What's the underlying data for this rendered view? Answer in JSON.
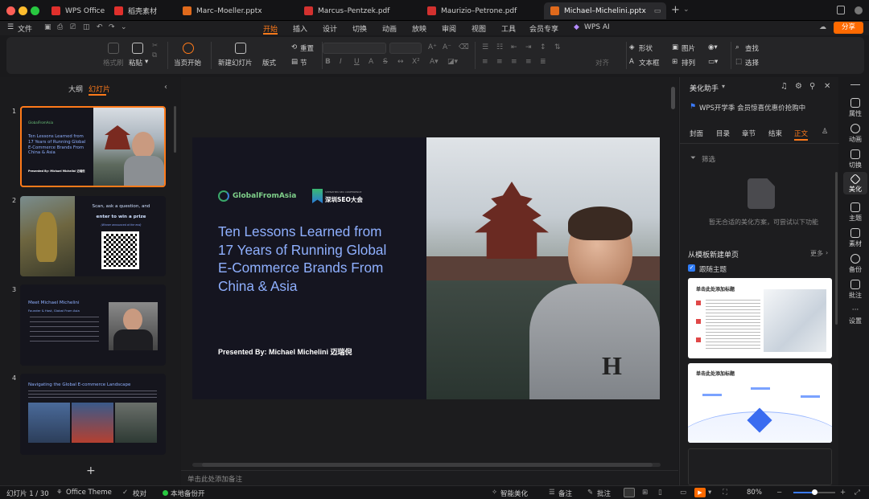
{
  "tabs": [
    {
      "label": "WPS Office",
      "color": "#e0302c"
    },
    {
      "label": "稻壳素材",
      "color": "#e0302c"
    },
    {
      "label": "Marc–Moeller.pptx",
      "color": "#e06a1c"
    },
    {
      "label": "Marcus–Pentzek.pdf",
      "color": "#d3312f"
    },
    {
      "label": "Maurizio–Petrone.pdf",
      "color": "#d3312f"
    },
    {
      "label": "Michael–Michelini.pptx",
      "color": "#e06a1c"
    }
  ],
  "menu": {
    "file": "文件",
    "items": [
      "开始",
      "插入",
      "设计",
      "切换",
      "动画",
      "放映",
      "审阅",
      "视图",
      "工具",
      "会员专享"
    ],
    "ai": "WPS AI",
    "share": "分享"
  },
  "ribbon": {
    "format_painter": "格式刷",
    "paste": "粘贴",
    "start_from_current": "当页开始",
    "new_slide": "新建幻灯片",
    "layout": "版式",
    "section": "节",
    "reset": "重置",
    "align": "对齐",
    "shape": "形状",
    "picture": "图片",
    "find": "查找",
    "textbox": "文本框",
    "arrange": "排列",
    "select": "选择"
  },
  "left_panel": {
    "outline_tab": "大纲",
    "slides_tab": "幻灯片",
    "add_button": "+"
  },
  "thumbs": [
    {
      "num": "1",
      "lines": [
        "Ten Lessons Learned from",
        "17 Years of Running Global",
        "E-Commerce Brands From",
        "China & Asia"
      ],
      "presenter": "Presented By: Michael Michelini 迈瑞倪"
    },
    {
      "num": "2",
      "l1": "Scan, ask a question, and",
      "l2": "enter to win a prize",
      "l3": "(Winner announced at the end)"
    },
    {
      "num": "3",
      "title": "Meet Michael Michelini",
      "sub": "Founder & Host, Global From Asia"
    },
    {
      "num": "4",
      "title": "Navigating the Global E-commerce Landscape"
    }
  ],
  "slide": {
    "logo1": "GlobalFromAsia",
    "logo2": "深圳SEO大会",
    "logo2_sub": "SHENZHEN SEO CONFERENCE",
    "title": [
      "Ten Lessons Learned from",
      "17 Years of Running Global",
      "E-Commerce Brands From",
      "China & Asia"
    ],
    "presenter": "Presented By: Michael Michelini 迈瑞倪"
  },
  "notes_placeholder": "单击此处添加备注",
  "right_panel": {
    "title": "美化助手",
    "promo": "WPS开学季 会员惊喜优惠价抢购中",
    "tabs": [
      "封面",
      "目录",
      "章节",
      "结束",
      "正文"
    ],
    "filter": "筛选",
    "empty": "暂无合适的美化方案，可尝试以下功能",
    "template_title": "从模板新建单页",
    "more": "更多",
    "follow": "跟随主题",
    "card_title": "单击此处添加标题"
  },
  "right_bar": [
    "属性",
    "动画",
    "切换",
    "美化",
    "主题",
    "素材",
    "备份",
    "批注",
    "设置"
  ],
  "status": {
    "slide_count": "幻灯片 1 / 30",
    "theme": "Office Theme",
    "proofread": "校对",
    "backup": "本地备份开",
    "smart": "智能美化",
    "notes": "备注",
    "comments": "批注",
    "zoom": "80%"
  },
  "colors": {
    "accent": "#ff7a1a",
    "slide_title": "#8fb0ff",
    "slide_bg": "#151520"
  }
}
